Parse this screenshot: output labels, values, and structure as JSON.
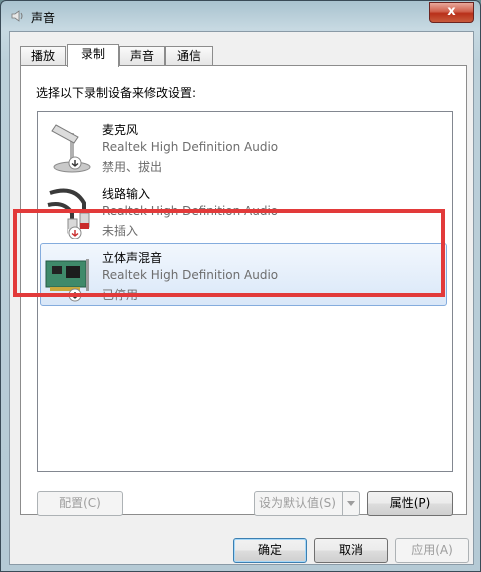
{
  "window": {
    "title": "声音",
    "close_label": "x"
  },
  "tabs": [
    {
      "label": "播放"
    },
    {
      "label": "录制"
    },
    {
      "label": "声音"
    },
    {
      "label": "通信"
    }
  ],
  "instruction": "选择以下录制设备来修改设置:",
  "devices": [
    {
      "name": "麦克风",
      "driver": "Realtek High Definition Audio",
      "status": "禁用、拔出",
      "icon": "microphone-icon"
    },
    {
      "name": "线路输入",
      "driver": "Realtek High Definition Audio",
      "status": "未插入",
      "icon": "rca-cable-icon"
    },
    {
      "name": "立体声混音",
      "driver": "Realtek High Definition Audio",
      "status": "已停用",
      "icon": "sound-card-icon",
      "selected": true
    }
  ],
  "panel_buttons": {
    "configure": "配置(C)",
    "set_default": "设为默认值(S)",
    "properties": "属性(P)"
  },
  "dialog_buttons": {
    "ok": "确定",
    "cancel": "取消",
    "apply": "应用(A)"
  },
  "colors": {
    "highlight": "#e23a3a",
    "selection": "#d9e7f8"
  }
}
